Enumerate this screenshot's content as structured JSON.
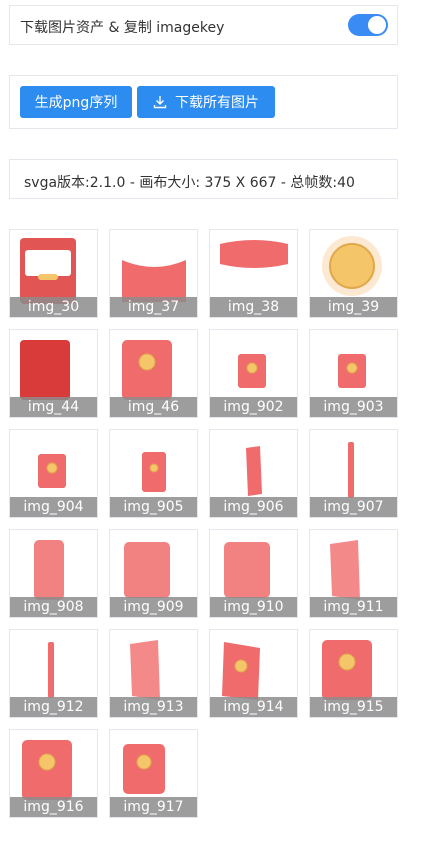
{
  "toolbar": {
    "download_assets_label": "下载图片资产 & 复制 imagekey",
    "toggle_on": true,
    "accent_color": "#2d8cf0"
  },
  "buttons": {
    "png_sequence": "生成png序列",
    "download_all": "下载所有图片"
  },
  "info": {
    "summary": "svga版本:2.1.0 - 画布大小: 375 X 667 - 总帧数:40"
  },
  "images": [
    {
      "name": "img_30",
      "art": "envelope-card"
    },
    {
      "name": "img_37",
      "art": "envelope-flap-curved"
    },
    {
      "name": "img_38",
      "art": "envelope-top"
    },
    {
      "name": "img_39",
      "art": "gold-coin"
    },
    {
      "name": "img_44",
      "art": "red-sheet"
    },
    {
      "name": "img_46",
      "art": "red-envelope-coin-large"
    },
    {
      "name": "img_902",
      "art": "red-envelope-coin-small"
    },
    {
      "name": "img_903",
      "art": "red-envelope-coin-small"
    },
    {
      "name": "img_904",
      "art": "red-envelope-coin-small"
    },
    {
      "name": "img_905",
      "art": "red-envelope-rotating"
    },
    {
      "name": "img_906",
      "art": "red-envelope-rotating-thin"
    },
    {
      "name": "img_907",
      "art": "red-envelope-edge"
    },
    {
      "name": "img_908",
      "art": "red-envelope-blur"
    },
    {
      "name": "img_909",
      "art": "red-envelope-blur-wide"
    },
    {
      "name": "img_910",
      "art": "red-envelope-blur-wide"
    },
    {
      "name": "img_911",
      "art": "red-envelope-blur-narrow"
    },
    {
      "name": "img_912",
      "art": "red-envelope-edge"
    },
    {
      "name": "img_913",
      "art": "red-envelope-blur-narrow"
    },
    {
      "name": "img_914",
      "art": "red-envelope-coin-tilted"
    },
    {
      "name": "img_915",
      "art": "red-envelope-coin-large"
    },
    {
      "name": "img_916",
      "art": "red-envelope-coin-large"
    },
    {
      "name": "img_917",
      "art": "red-envelope-coin-medium"
    }
  ]
}
